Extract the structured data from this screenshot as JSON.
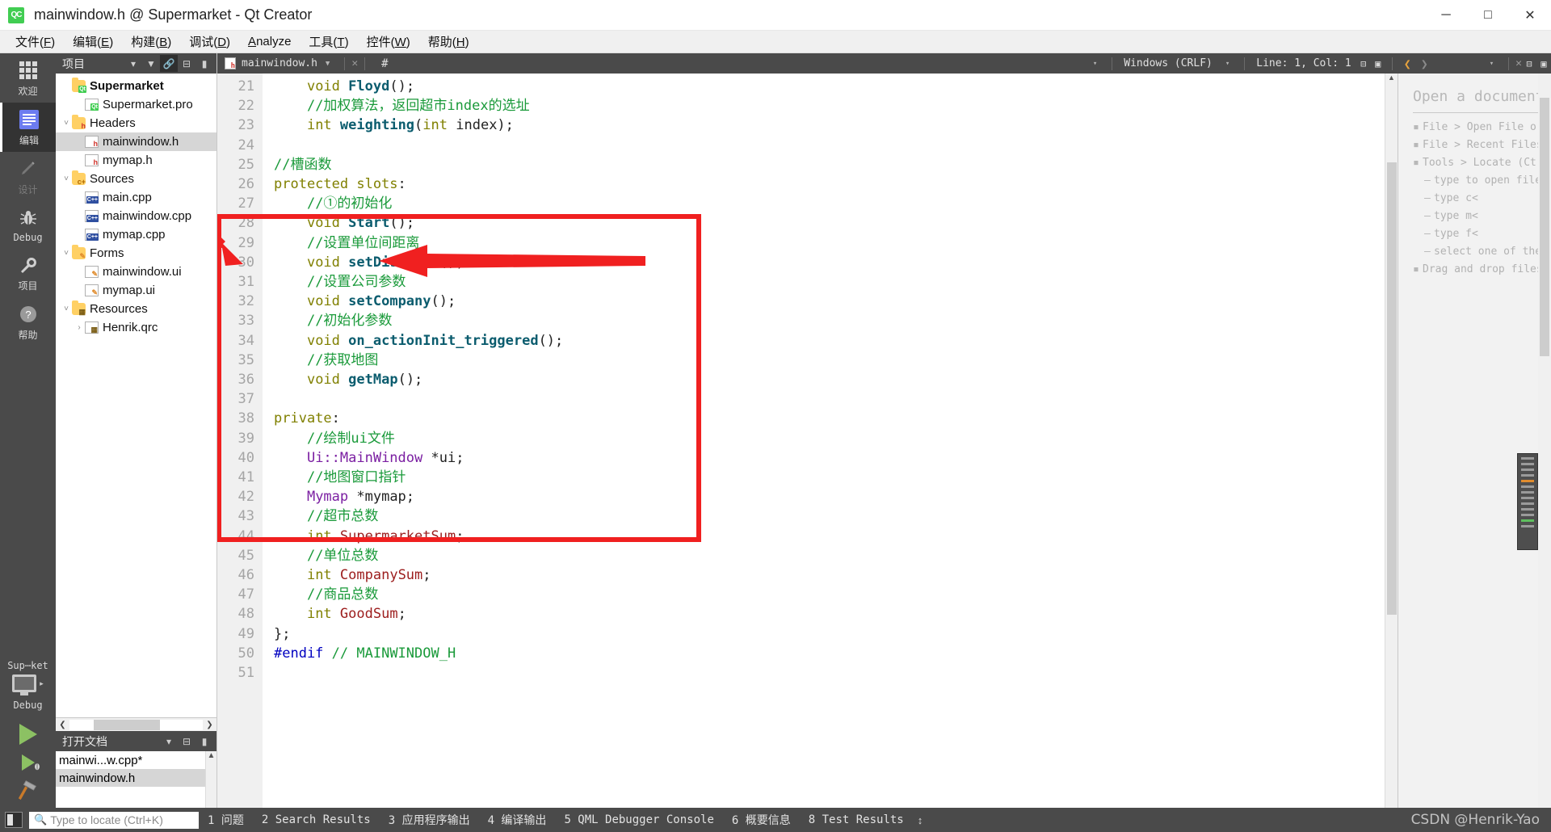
{
  "window": {
    "title": "mainwindow.h @ Supermarket - Qt Creator",
    "logo_text": "QC",
    "minimize": "─",
    "maximize": "□",
    "close": "✕"
  },
  "menubar": [
    {
      "label": "文件(F)"
    },
    {
      "label": "编辑(E)"
    },
    {
      "label": "构建(B)"
    },
    {
      "label": "调试(D)"
    },
    {
      "label": "Analyze"
    },
    {
      "label": "工具(T)"
    },
    {
      "label": "控件(W)"
    },
    {
      "label": "帮助(H)"
    }
  ],
  "modebar": {
    "modes": [
      {
        "label": "欢迎",
        "icon": "grid-icon",
        "state": "normal"
      },
      {
        "label": "编辑",
        "icon": "edit-icon",
        "state": "active"
      },
      {
        "label": "设计",
        "icon": "pencil-icon",
        "state": "disabled"
      },
      {
        "label": "Debug",
        "icon": "bug-icon",
        "state": "normal"
      },
      {
        "label": "项目",
        "icon": "wrench-icon",
        "state": "normal"
      },
      {
        "label": "帮助",
        "icon": "question-icon",
        "state": "normal"
      }
    ],
    "kit_name": "Sup⋯ket",
    "build_config": "Debug",
    "run_label": "run",
    "debug_label": "debug",
    "build_label": "build"
  },
  "project_panel": {
    "title": "项目",
    "buttons": [
      "filter-icon",
      "link-icon",
      "split-icon",
      "close-icon"
    ],
    "tree": [
      {
        "depth": 0,
        "label": "Supermarket",
        "icon": "qt-project-icon",
        "twisty": "",
        "bold": true,
        "selected": false
      },
      {
        "depth": 1,
        "label": "Supermarket.pro",
        "icon": "pro-file-icon",
        "twisty": "",
        "bold": false,
        "selected": false
      },
      {
        "depth": 0,
        "label": "Headers",
        "icon": "folder-h-icon",
        "twisty": "v",
        "bold": false,
        "selected": false
      },
      {
        "depth": 1,
        "label": "mainwindow.h",
        "icon": "header-file-icon",
        "twisty": "",
        "bold": false,
        "selected": true
      },
      {
        "depth": 1,
        "label": "mymap.h",
        "icon": "header-file-icon",
        "twisty": "",
        "bold": false,
        "selected": false
      },
      {
        "depth": 0,
        "label": "Sources",
        "icon": "folder-cpp-icon",
        "twisty": "v",
        "bold": false,
        "selected": false
      },
      {
        "depth": 1,
        "label": "main.cpp",
        "icon": "cpp-file-icon",
        "twisty": "",
        "bold": false,
        "selected": false
      },
      {
        "depth": 1,
        "label": "mainwindow.cpp",
        "icon": "cpp-file-icon",
        "twisty": "",
        "bold": false,
        "selected": false
      },
      {
        "depth": 1,
        "label": "mymap.cpp",
        "icon": "cpp-file-icon",
        "twisty": "",
        "bold": false,
        "selected": false
      },
      {
        "depth": 0,
        "label": "Forms",
        "icon": "folder-ui-icon",
        "twisty": "v",
        "bold": false,
        "selected": false
      },
      {
        "depth": 1,
        "label": "mainwindow.ui",
        "icon": "ui-file-icon",
        "twisty": "",
        "bold": false,
        "selected": false
      },
      {
        "depth": 1,
        "label": "mymap.ui",
        "icon": "ui-file-icon",
        "twisty": "",
        "bold": false,
        "selected": false
      },
      {
        "depth": 0,
        "label": "Resources",
        "icon": "folder-qrc-icon",
        "twisty": "v",
        "bold": false,
        "selected": false
      },
      {
        "depth": 1,
        "label": "Henrik.qrc",
        "icon": "qrc-file-icon",
        "twisty": ">",
        "bold": false,
        "selected": false
      }
    ]
  },
  "open_documents": {
    "title": "打开文档",
    "items": [
      {
        "label": "mainwi...w.cpp*",
        "selected": false
      },
      {
        "label": "mainwindow.h",
        "selected": true
      }
    ]
  },
  "editor_toolbar": {
    "file_name": "mainwindow.h",
    "dropdown_caret": "▼",
    "close_label": "✕",
    "symbol_selector": "#",
    "line_ending": "Windows (CRLF)",
    "cursor_position": "Line: 1, Col: 1",
    "split_label": "⧉",
    "split_close_label": "▣",
    "nav_back": "❮",
    "nav_forward": "❯"
  },
  "code": {
    "first_line_number": 21,
    "lines": [
      {
        "n": 21,
        "tokens": [
          {
            "t": "    ",
            "c": "plain"
          },
          {
            "t": "void",
            "c": "kw"
          },
          {
            "t": " ",
            "c": "plain"
          },
          {
            "t": "Floyd",
            "c": "fn"
          },
          {
            "t": "();",
            "c": "plain"
          }
        ]
      },
      {
        "n": 22,
        "tokens": [
          {
            "t": "    ",
            "c": "plain"
          },
          {
            "t": "//加权算法，返回超市index的选址",
            "c": "cm"
          }
        ]
      },
      {
        "n": 23,
        "tokens": [
          {
            "t": "    ",
            "c": "plain"
          },
          {
            "t": "int",
            "c": "kw"
          },
          {
            "t": " ",
            "c": "plain"
          },
          {
            "t": "weighting",
            "c": "fn"
          },
          {
            "t": "(",
            "c": "plain"
          },
          {
            "t": "int",
            "c": "kw"
          },
          {
            "t": " index);",
            "c": "plain"
          }
        ]
      },
      {
        "n": 24,
        "tokens": []
      },
      {
        "n": 25,
        "tokens": [
          {
            "t": "//槽函数",
            "c": "cm"
          }
        ]
      },
      {
        "n": 26,
        "tokens": [
          {
            "t": "protected slots",
            "c": "kw"
          },
          {
            "t": ":",
            "c": "plain"
          }
        ]
      },
      {
        "n": 27,
        "tokens": [
          {
            "t": "    ",
            "c": "plain"
          },
          {
            "t": "//①的初始化",
            "c": "cm"
          }
        ]
      },
      {
        "n": 28,
        "tokens": [
          {
            "t": "    ",
            "c": "plain"
          },
          {
            "t": "void",
            "c": "kw"
          },
          {
            "t": " ",
            "c": "plain"
          },
          {
            "t": "Start",
            "c": "fn"
          },
          {
            "t": "();",
            "c": "plain"
          }
        ]
      },
      {
        "n": 29,
        "tokens": [
          {
            "t": "    ",
            "c": "plain"
          },
          {
            "t": "//设置单位间距离",
            "c": "cm"
          }
        ]
      },
      {
        "n": 30,
        "tokens": [
          {
            "t": "    ",
            "c": "plain"
          },
          {
            "t": "void",
            "c": "kw"
          },
          {
            "t": " ",
            "c": "plain"
          },
          {
            "t": "setDistance",
            "c": "fn"
          },
          {
            "t": "();",
            "c": "plain"
          }
        ]
      },
      {
        "n": 31,
        "tokens": [
          {
            "t": "    ",
            "c": "plain"
          },
          {
            "t": "//设置公司参数",
            "c": "cm"
          }
        ]
      },
      {
        "n": 32,
        "tokens": [
          {
            "t": "    ",
            "c": "plain"
          },
          {
            "t": "void",
            "c": "kw"
          },
          {
            "t": " ",
            "c": "plain"
          },
          {
            "t": "setCompany",
            "c": "fn"
          },
          {
            "t": "();",
            "c": "plain"
          }
        ]
      },
      {
        "n": 33,
        "tokens": [
          {
            "t": "    ",
            "c": "plain"
          },
          {
            "t": "//初始化参数",
            "c": "cm"
          }
        ]
      },
      {
        "n": 34,
        "tokens": [
          {
            "t": "    ",
            "c": "plain"
          },
          {
            "t": "void",
            "c": "kw"
          },
          {
            "t": " ",
            "c": "plain"
          },
          {
            "t": "on_actionInit_triggered",
            "c": "fn"
          },
          {
            "t": "();",
            "c": "plain"
          }
        ]
      },
      {
        "n": 35,
        "tokens": [
          {
            "t": "    ",
            "c": "plain"
          },
          {
            "t": "//获取地图",
            "c": "cm"
          }
        ]
      },
      {
        "n": 36,
        "tokens": [
          {
            "t": "    ",
            "c": "plain"
          },
          {
            "t": "void",
            "c": "kw"
          },
          {
            "t": " ",
            "c": "plain"
          },
          {
            "t": "getMap",
            "c": "fn"
          },
          {
            "t": "();",
            "c": "plain"
          }
        ]
      },
      {
        "n": 37,
        "tokens": []
      },
      {
        "n": 38,
        "tokens": [
          {
            "t": "private",
            "c": "kw"
          },
          {
            "t": ":",
            "c": "plain"
          }
        ]
      },
      {
        "n": 39,
        "tokens": [
          {
            "t": "    ",
            "c": "plain"
          },
          {
            "t": "//绘制ui文件",
            "c": "cm"
          }
        ]
      },
      {
        "n": 40,
        "tokens": [
          {
            "t": "    ",
            "c": "plain"
          },
          {
            "t": "Ui::MainWindow",
            "c": "ty"
          },
          {
            "t": " *ui;",
            "c": "plain"
          }
        ]
      },
      {
        "n": 41,
        "tokens": [
          {
            "t": "    ",
            "c": "plain"
          },
          {
            "t": "//地图窗口指针",
            "c": "cm"
          }
        ]
      },
      {
        "n": 42,
        "tokens": [
          {
            "t": "    ",
            "c": "plain"
          },
          {
            "t": "Mymap",
            "c": "ty"
          },
          {
            "t": " *mymap;",
            "c": "plain"
          }
        ]
      },
      {
        "n": 43,
        "tokens": [
          {
            "t": "    ",
            "c": "plain"
          },
          {
            "t": "//超市总数",
            "c": "cm"
          }
        ]
      },
      {
        "n": 44,
        "tokens": [
          {
            "t": "    ",
            "c": "plain"
          },
          {
            "t": "int",
            "c": "kw"
          },
          {
            "t": " ",
            "c": "plain"
          },
          {
            "t": "SupermarketSum",
            "c": "var"
          },
          {
            "t": ";",
            "c": "plain"
          }
        ]
      },
      {
        "n": 45,
        "tokens": [
          {
            "t": "    ",
            "c": "plain"
          },
          {
            "t": "//单位总数",
            "c": "cm"
          }
        ]
      },
      {
        "n": 46,
        "tokens": [
          {
            "t": "    ",
            "c": "plain"
          },
          {
            "t": "int",
            "c": "kw"
          },
          {
            "t": " ",
            "c": "plain"
          },
          {
            "t": "CompanySum",
            "c": "var"
          },
          {
            "t": ";",
            "c": "plain"
          }
        ]
      },
      {
        "n": 47,
        "tokens": [
          {
            "t": "    ",
            "c": "plain"
          },
          {
            "t": "//商品总数",
            "c": "cm"
          }
        ]
      },
      {
        "n": 48,
        "tokens": [
          {
            "t": "    ",
            "c": "plain"
          },
          {
            "t": "int",
            "c": "kw"
          },
          {
            "t": " ",
            "c": "plain"
          },
          {
            "t": "GoodSum",
            "c": "var"
          },
          {
            "t": ";",
            "c": "plain"
          }
        ]
      },
      {
        "n": 49,
        "tokens": [
          {
            "t": "};",
            "c": "plain"
          }
        ]
      },
      {
        "n": 50,
        "tokens": [
          {
            "t": "#endif",
            "c": "pp"
          },
          {
            "t": " ",
            "c": "plain"
          },
          {
            "t": "// MAINWINDOW_H",
            "c": "cm"
          }
        ]
      },
      {
        "n": 51,
        "tokens": []
      }
    ]
  },
  "annotation": {
    "box_color": "#f02020",
    "arrow_color": "#f02020",
    "box_start_line": 25,
    "box_end_line": 37
  },
  "right_pane": {
    "title": "Open a document",
    "items": [
      {
        "bullet": "▪",
        "text": "File > Open File or",
        "sub": false
      },
      {
        "bullet": "▪",
        "text": "File > Recent Files",
        "sub": false
      },
      {
        "bullet": "▪",
        "text": "Tools > Locate (Ctr",
        "sub": false
      },
      {
        "bullet": "–",
        "text": "type to open file",
        "sub": true
      },
      {
        "bullet": "–",
        "text": "type c<space><",
        "sub": true
      },
      {
        "bullet": "–",
        "text": "type m<space><",
        "sub": true
      },
      {
        "bullet": "–",
        "text": "type f<space><",
        "sub": true
      },
      {
        "bullet": "–",
        "text": "select one of the",
        "sub": true
      },
      {
        "bullet": "▪",
        "text": "Drag and drop files",
        "sub": false
      }
    ]
  },
  "statusbar": {
    "locate_placeholder": "Type to locate (Ctrl+K)",
    "locate_icon": "search-icon",
    "panels": [
      "1 问题",
      "2 Search Results",
      "3 应用程序输出",
      "4 编译输出",
      "5 QML Debugger Console",
      "6 概要信息",
      "8 Test Results"
    ],
    "updown": "↕",
    "watermark": "CSDN @Henrik-Yao"
  }
}
